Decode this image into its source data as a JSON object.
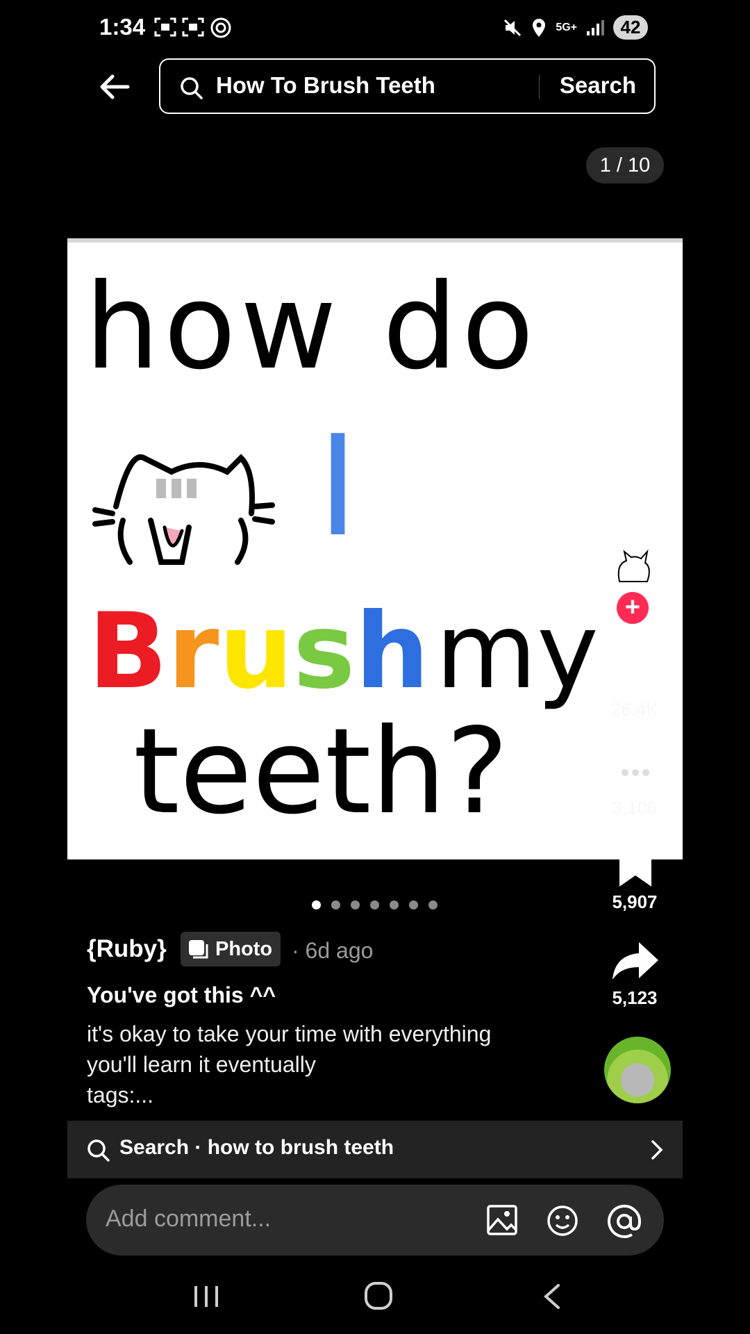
{
  "status_bar": {
    "time": "1:34",
    "network": "5G+",
    "battery": "42",
    "icons": [
      "screenshot-icon",
      "screen-record-icon",
      "at-sign-icon",
      "mute-icon",
      "location-icon",
      "signal-icon"
    ]
  },
  "header": {
    "search_query": "How To Brush Teeth",
    "search_button": "Search"
  },
  "photo": {
    "page_counter": "1 / 10",
    "current_index": 1,
    "total_images": 10,
    "image_text": [
      "how do",
      "I",
      "Brush",
      "my",
      "teeth?"
    ],
    "visible_dots": 7
  },
  "actions": {
    "likes": "26.4K",
    "comments": "3,106",
    "saves": "5,907",
    "shares": "5,123"
  },
  "post": {
    "author": "{Ruby}",
    "badge": "Photo",
    "time_ago": "· 6d ago",
    "title": "You've got this ^^",
    "body_lines": [
      "it's okay to take your time with everything",
      "you'll learn it eventually",
      "tags:..."
    ]
  },
  "suggestion": {
    "text": "Search · how to brush teeth"
  },
  "comment_bar": {
    "placeholder": "Add comment..."
  },
  "colors": {
    "accent": "#fe2c55",
    "background": "#000000",
    "bar": "#232323"
  }
}
